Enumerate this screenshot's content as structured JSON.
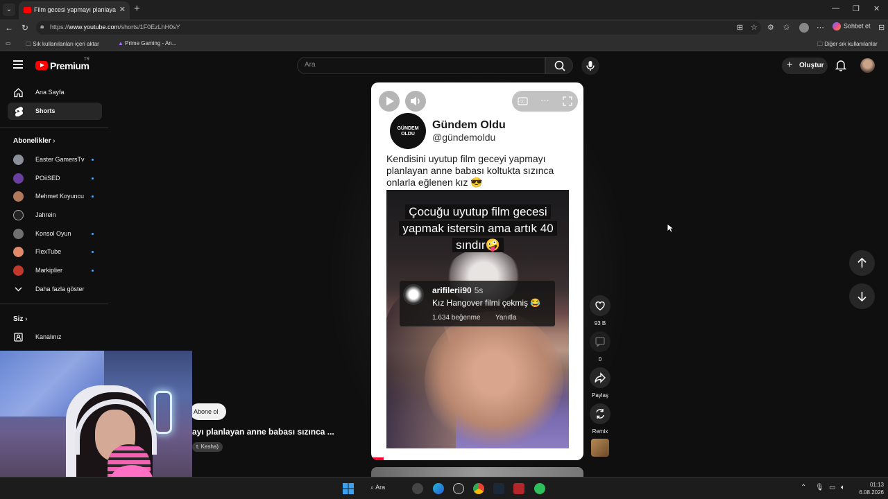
{
  "browser": {
    "tab_title": "Film gecesi yapmayı planlayan anne",
    "url_prefix": "https://",
    "url_domain": "www.youtube.com",
    "url_path": "/shorts/1F0EzLhH0sY",
    "copilot_label": "Sohbet et",
    "favorites": {
      "import_label": "Sık kullanılanları içeri aktar",
      "prime_label": "Prime Gaming - An...",
      "other_label": "Diğer sık kullanılanlar"
    }
  },
  "youtube": {
    "logo_text": "Premium",
    "logo_country": "TR",
    "search_placeholder": "Ara",
    "create_label": "Oluştur",
    "sidebar": {
      "home": "Ana Sayfa",
      "shorts": "Shorts",
      "subscriptions_title": "Abonelikler",
      "subscriptions": [
        {
          "name": "Easter GamersTv",
          "new": true,
          "color": "#8a8f99"
        },
        {
          "name": "POiiSED",
          "new": true,
          "color": "#6a3fa0"
        },
        {
          "name": "Mehmet Koyuncu",
          "new": true,
          "color": "#b07a5a"
        },
        {
          "name": "Jahrein",
          "new": false,
          "color": "#222222"
        },
        {
          "name": "Konsol Oyun",
          "new": true,
          "color": "#707070"
        },
        {
          "name": "FlexTube",
          "new": true,
          "color": "#e08a6a"
        },
        {
          "name": "Markiplier",
          "new": true,
          "color": "#c0392b"
        }
      ],
      "show_more": "Daha fazla göster",
      "you_title": "Siz",
      "your_channel": "Kanalınız"
    },
    "short": {
      "channel_name": "Gündem Oldu",
      "channel_handle": "@gündemoldu",
      "channel_logo_text": "GÜNDEM OLDU",
      "caption": "Kendisini uyutup film geceyi yapmayı planlayan anne babası koltukta sızınca onlarla eğlenen kız 😎",
      "video_overlay": "Çocuğu uyutup film gecesi yapmak istersin ama artık 40 sındır🤪",
      "comment": {
        "user": "arifilerii90",
        "age": "5s",
        "text": "Kız Hangover filmi çekmiş 😂",
        "likes": "1.634 beğenme",
        "reply": "Yanıtla"
      },
      "progress": 0.06
    },
    "actions": {
      "likes": "93 B",
      "comments": "0",
      "share": "Paylaş",
      "remix": "Remix"
    },
    "overlay": {
      "subscribe": "Abone ol",
      "title": "ayı planlayan anne babası sızınca ...",
      "sound": "t. Kesha)"
    }
  },
  "taskbar": {
    "search_label": "Ara",
    "time": "01:13",
    "date": "6.08.2026"
  }
}
